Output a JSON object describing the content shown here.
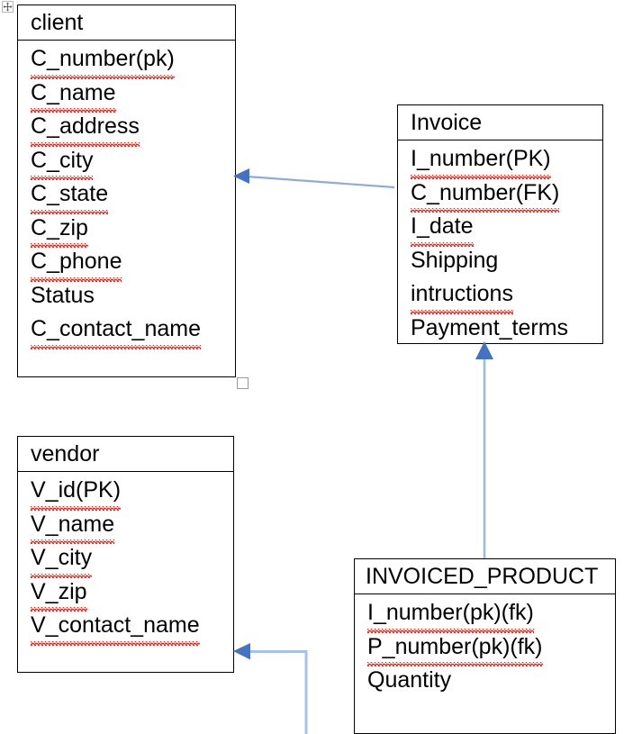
{
  "document": {
    "type": "entity-relationship-diagram",
    "move_handle_icon": "move-four-arrows-icon"
  },
  "entities": [
    {
      "id": "client",
      "title": "client",
      "attributes": [
        {
          "text": "C_number(pk)",
          "misspelled": "C_number",
          "grammar_mark": true
        },
        {
          "text": "C_name",
          "misspelled": "C_name",
          "grammar_mark": false
        },
        {
          "text": "C_address",
          "misspelled": "C_address",
          "grammar_mark": false
        },
        {
          "text": "C_city",
          "misspelled": "C_city",
          "grammar_mark": false
        },
        {
          "text": "C_state",
          "misspelled": "C_state",
          "grammar_mark": false
        },
        {
          "text": "C_zip",
          "misspelled": "C_zip",
          "grammar_mark": false
        },
        {
          "text": "C_phone",
          "misspelled": "C_phone",
          "grammar_mark": false
        },
        {
          "text": "Status",
          "misspelled": "",
          "grammar_mark": false
        },
        {
          "text": "C_contact_name",
          "misspelled": "C_contact_name",
          "grammar_mark": false
        }
      ]
    },
    {
      "id": "invoice",
      "title": "Invoice",
      "attributes": [
        {
          "text": "I_number(PK)",
          "misspelled": "I_number",
          "grammar_mark": true
        },
        {
          "text": "C_number(FK)",
          "misspelled": "C_number",
          "grammar_mark": true
        },
        {
          "text": "I_date",
          "misspelled": "I_date",
          "grammar_mark": false
        },
        {
          "text": "Shipping",
          "misspelled": "",
          "grammar_mark": false
        },
        {
          "text": "intructions",
          "misspelled": "intructions",
          "grammar_mark": false
        },
        {
          "text": "Payment_terms",
          "misspelled": "Payment_terms",
          "grammar_mark": false
        }
      ]
    },
    {
      "id": "vendor",
      "title": "vendor",
      "attributes": [
        {
          "text": " V_id(PK)",
          "misspelled": "V_id",
          "grammar_mark": true
        },
        {
          "text": "V_name",
          "misspelled": "V_name",
          "grammar_mark": false
        },
        {
          "text": "V_city",
          "misspelled": "V_city",
          "grammar_mark": false
        },
        {
          "text": "V_zip",
          "misspelled": "V_zip",
          "grammar_mark": false
        },
        {
          "text": "V_contact_name",
          "misspelled": "V_contact_name",
          "grammar_mark": false
        }
      ]
    },
    {
      "id": "invoiced_product",
      "title": "INVOICED_PRODUCT",
      "attributes": [
        {
          "text": "I_number(pk)(fk)",
          "misspelled": "I_number",
          "grammar_mark": false
        },
        {
          "text": "P_number(pk)(fk)",
          "misspelled": "P_number",
          "grammar_mark": false
        },
        {
          "text": "Quantity",
          "misspelled": "",
          "grammar_mark": false
        }
      ]
    }
  ],
  "connectors": [
    {
      "id": "invoice-to-client",
      "from": "invoice",
      "to": "client",
      "style": "straight-arrow"
    },
    {
      "id": "invoiced-product-to-invoice",
      "from": "invoiced_product",
      "to": "invoice",
      "style": "straight-arrow"
    },
    {
      "id": "product-to-vendor",
      "from": "off-canvas",
      "to": "vendor",
      "style": "elbow-arrow"
    }
  ],
  "colors": {
    "connector": "#4472C4",
    "connector_light": "#A9C0E8",
    "border": "#000000",
    "spellcheck": "#E8291C",
    "grammar": "#2F5FB0",
    "handle": "#9A9A9A"
  }
}
